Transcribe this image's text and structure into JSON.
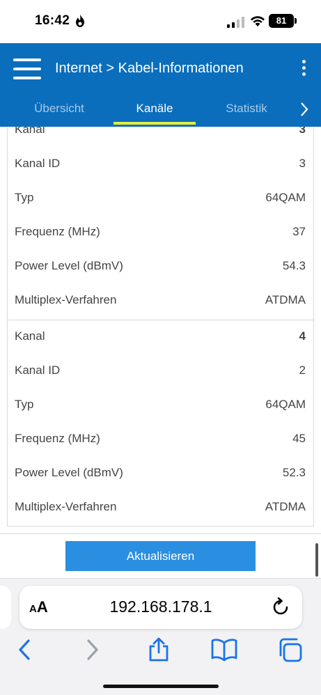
{
  "status_bar": {
    "time": "16:42",
    "battery": "81"
  },
  "header": {
    "title": "Internet > Kabel-Informationen",
    "tabs": [
      {
        "label": "Übersicht",
        "active": false
      },
      {
        "label": "Kanäle",
        "active": true
      },
      {
        "label": "Statistik",
        "active": false
      }
    ]
  },
  "channels": [
    {
      "rows": [
        {
          "label": "Kanal",
          "value": "3"
        },
        {
          "label": "Kanal ID",
          "value": "3"
        },
        {
          "label": "Typ",
          "value": "64QAM"
        },
        {
          "label": "Frequenz (MHz)",
          "value": "37"
        },
        {
          "label": "Power Level (dBmV)",
          "value": "54.3"
        },
        {
          "label": "Multiplex-Verfahren",
          "value": "ATDMA"
        }
      ]
    },
    {
      "rows": [
        {
          "label": "Kanal",
          "value": "4"
        },
        {
          "label": "Kanal ID",
          "value": "2"
        },
        {
          "label": "Typ",
          "value": "64QAM"
        },
        {
          "label": "Frequenz (MHz)",
          "value": "45"
        },
        {
          "label": "Power Level (dBmV)",
          "value": "52.3"
        },
        {
          "label": "Multiplex-Verfahren",
          "value": "ATDMA"
        }
      ]
    }
  ],
  "refresh_button": {
    "label": "Aktualisieren"
  },
  "browser": {
    "text_size_label_small": "A",
    "text_size_label_large": "A",
    "url": "192.168.178.1"
  },
  "colors": {
    "header": "#0a6ebd",
    "tab_underline": "#e6ee3a",
    "button": "#2a8fe0",
    "safari_blue": "#1a73e8"
  }
}
